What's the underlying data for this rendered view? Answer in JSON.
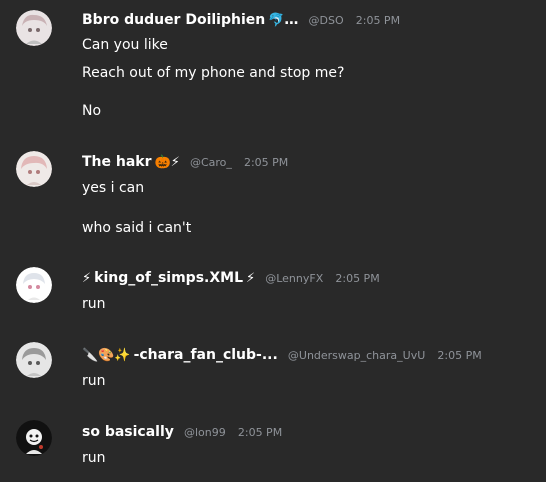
{
  "messages": [
    {
      "name": "Bbro duduer Doiliphien",
      "name_suffix": "…",
      "emoji_after": "🐬",
      "handle": "@DSO",
      "time": "2:05 PM",
      "lines": [
        "Can you like",
        "Reach out of my phone and stop me?",
        "No"
      ],
      "avatar_icon": "anime-avatar-icon"
    },
    {
      "name": "The hakr",
      "emoji_after": "🎃⚡",
      "handle": "@Caro_",
      "time": "2:05 PM",
      "lines": [
        "yes i can",
        "who said i can't"
      ],
      "avatar_icon": "anime-avatar-icon"
    },
    {
      "name": "king_of_simps.XML",
      "emoji_before": "⚡",
      "emoji_after": "⚡",
      "handle": "@LennyFX",
      "time": "2:05 PM",
      "lines": [
        "run"
      ],
      "avatar_icon": "anime-avatar-icon"
    },
    {
      "name": "-chara_fan_club-...",
      "emoji_before": "🔪🎨✨",
      "handle": "@Underswap_chara_UvU",
      "time": "2:05 PM",
      "lines": [
        "run"
      ],
      "avatar_icon": "anime-avatar-icon"
    },
    {
      "name": "so basically",
      "handle": "@lon99",
      "time": "2:05 PM",
      "lines": [
        "run"
      ],
      "avatar_icon": "dark-avatar-icon"
    }
  ]
}
